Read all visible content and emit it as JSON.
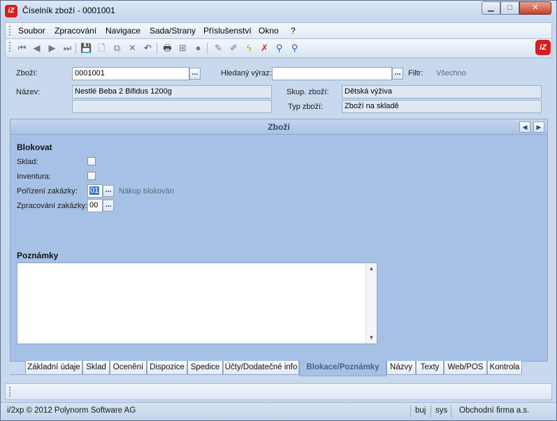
{
  "window": {
    "title": "Číselník zboží - 0001001",
    "logo_text": "iZ"
  },
  "menu": [
    "Soubor",
    "Zpracování",
    "Navigace",
    "Sada/Strany",
    "Příslušenství",
    "Okno",
    "?"
  ],
  "header": {
    "zbozi_label": "Zboží:",
    "zbozi_value": "0001001",
    "hledany_label": "Hledaný výraz:",
    "hledany_value": "",
    "filtr_label": "Filtr:",
    "filtr_value": "Všechno",
    "nazev_label": "Název:",
    "nazev_value": "Nestlé Beba 2 Bifidus 1200g",
    "nazev2_value": "",
    "skup_label": "Skup. zboží:",
    "skup_value": "Dětská výživa",
    "typ_label": "Typ zboží:",
    "typ_value": "Zboží na skladě",
    "dots": "..."
  },
  "panel": {
    "title": "Zboží",
    "blokovat_heading": "Blokovat",
    "sklad_label": "Sklad:",
    "inventura_label": "Inventura:",
    "porizeni_label": "Pořízení zakázky:",
    "porizeni_value": "01",
    "porizeni_desc": "Nákup blokován",
    "zpracovani_label": "Zpracování zakázky:",
    "zpracovani_value": "00",
    "poznamky_heading": "Poznámky"
  },
  "tabs": [
    {
      "label": "Základní údaje",
      "active": false
    },
    {
      "label": "Sklad",
      "active": false
    },
    {
      "label": "Ocenění",
      "active": false
    },
    {
      "label": "Dispozice",
      "active": false
    },
    {
      "label": "Spedice",
      "active": false
    },
    {
      "label": "Účty/Dodatečné info",
      "active": false
    },
    {
      "label": "Blokace/Poznámky",
      "active": true
    },
    {
      "label": "Názvy",
      "active": false
    },
    {
      "label": "Texty",
      "active": false
    },
    {
      "label": "Web/POS",
      "active": false
    },
    {
      "label": "Kontrola",
      "active": false
    }
  ],
  "status": {
    "copyright": "i/2xp © 2012 Polynorm Software AG",
    "user": "buj",
    "db": "sys",
    "company": "Obchodní firma a.s."
  },
  "colors": {
    "accent": "#d61e1e",
    "panel_bg": "#a7c1e6"
  }
}
